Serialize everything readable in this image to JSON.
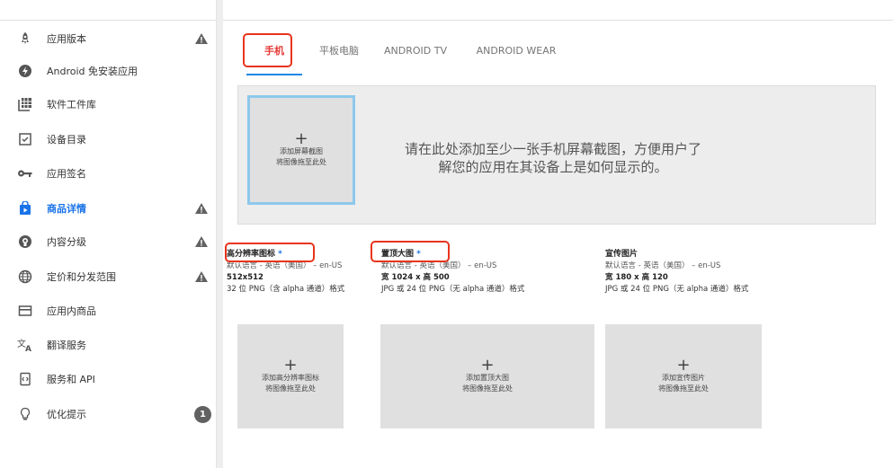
{
  "sidebar": {
    "items": [
      {
        "label": "应用版本",
        "icon": "rocket-icon",
        "warning": true
      },
      {
        "label": "Android 免安装应用",
        "icon": "bolt-icon"
      },
      {
        "label": "软件工件库",
        "icon": "library-icon"
      },
      {
        "label": "设备目录",
        "icon": "device-catalog-icon"
      },
      {
        "label": "应用签名",
        "icon": "key-icon"
      },
      {
        "label": "商品详情",
        "icon": "store-listing-icon",
        "active": true,
        "warning": true
      },
      {
        "label": "内容分级",
        "icon": "content-rating-icon",
        "warning": true
      },
      {
        "label": "定价和分发范围",
        "icon": "globe-icon",
        "warning": true
      },
      {
        "label": "应用内商品",
        "icon": "card-icon"
      },
      {
        "label": "翻译服务",
        "icon": "translate-icon"
      },
      {
        "label": "服务和 API",
        "icon": "api-icon"
      },
      {
        "label": "优化提示",
        "icon": "lightbulb-icon",
        "badge": "1"
      }
    ]
  },
  "tabs": [
    {
      "label": "手机",
      "active": true
    },
    {
      "label": "平板电脑"
    },
    {
      "label": "ANDROID TV"
    },
    {
      "label": "ANDROID WEAR"
    }
  ],
  "screenshots": {
    "add_plus": "+",
    "add_line1": "添加屏幕截图",
    "add_line2": "将图像拖至此处",
    "hint_line1": "请在此处添加至少一张手机屏幕截图，方便用户了",
    "hint_line2": "解您的应用在其设备上是如何显示的。"
  },
  "assets": [
    {
      "title": "高分辨率图标",
      "required": "*",
      "lang": "默认语言 - 英语（美国） – en-US",
      "size": "512x512",
      "format": "32 位 PNG（含 alpha 通道）格式",
      "drop_plus": "+",
      "drop_line1": "添加高分辨率图标",
      "drop_line2": "将图像拖至此处"
    },
    {
      "title": "置顶大图",
      "required": "*",
      "lang": "默认语言 - 英语（美国） – en-US",
      "size": "宽 1024 x 高 500",
      "format": "JPG 或 24 位 PNG（无 alpha 通道）格式",
      "drop_plus": "+",
      "drop_line1": "添加置顶大图",
      "drop_line2": "将图像拖至此处"
    },
    {
      "title": "宣传图片",
      "required": "",
      "lang": "默认语言 - 英语（美国） – en-US",
      "size": "宽 180 x 高 120",
      "format": "JPG 或 24 位 PNG（无 alpha 通道）格式",
      "drop_plus": "+",
      "drop_line1": "添加宣传图片",
      "drop_line2": "将图像拖至此处"
    }
  ],
  "colors": {
    "accent": "#1a73e8",
    "highlight": "#e8341c",
    "warning": "#616161"
  }
}
